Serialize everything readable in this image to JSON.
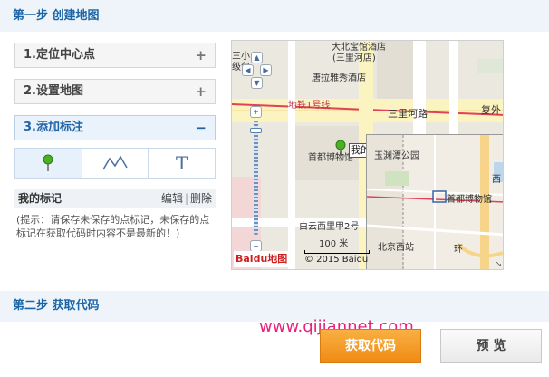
{
  "step1": {
    "title": "第一步 创建地图"
  },
  "accordion": [
    {
      "label": "1.定位中心点",
      "symbol": "+"
    },
    {
      "label": "2.设置地图",
      "symbol": "+"
    },
    {
      "label": "3.添加标注",
      "symbol": "−"
    }
  ],
  "tools": {
    "text_tool": "T"
  },
  "my_marks": {
    "title": "我的标记",
    "edit": "编辑",
    "separator": "|",
    "delete": "删除"
  },
  "tip": "(提示：请保存未保存的点标记，未保存的点标记在获取代码时内容不是最新的！)",
  "map": {
    "labels": {
      "top_hotel1": "大北宝馆酒店",
      "sanli": "三小",
      "jiye": "级包",
      "sanlihe_shop": "(三里河店)",
      "tanglu": "唐拉雅秀酒店",
      "subway": "地铁1号线",
      "sanlihe_road": "三里河路",
      "fuwai": "复外",
      "museum": "首都博物馆",
      "baiyun": "白云西里甲2号",
      "yuyuantan": "玉渊潭公园",
      "museum_mini": "首都博物馆",
      "west": "西",
      "beijing_west": "北京西站",
      "ring": "环",
      "bubble": "我的",
      "scale": "100 米",
      "copyright": "© 2015 Baidu",
      "logo": "Baidu地图"
    }
  },
  "step2": {
    "title": "第二步 获取代码"
  },
  "buttons": {
    "get_code": "获取代码",
    "preview": "预 览"
  },
  "watermark": "www.qijiannet.com"
}
